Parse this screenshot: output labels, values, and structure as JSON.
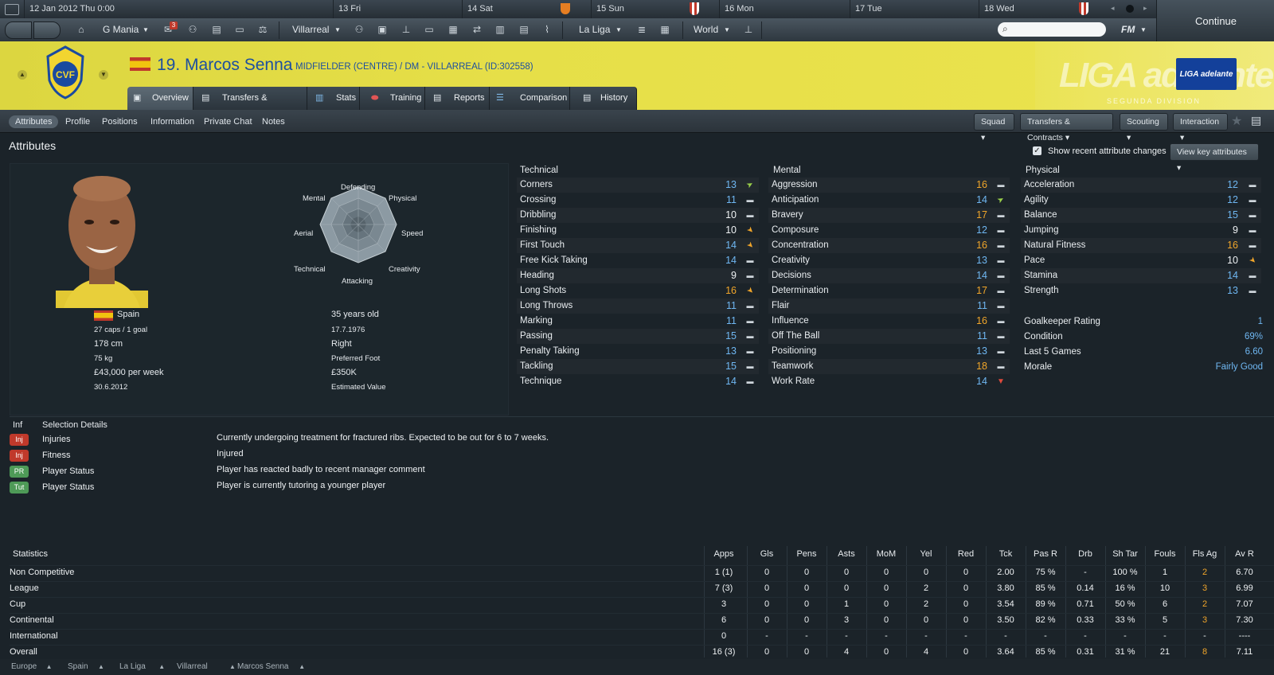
{
  "calendar": {
    "today": "12 Jan 2012  Thu  0:00",
    "days": [
      "13  Fri",
      "14  Sat",
      "15  Sun",
      "16  Mon",
      "17  Tue",
      "18  Wed"
    ]
  },
  "continue_label": "Continue",
  "toolbar": {
    "manager": "G Mania",
    "inbox_count": "3",
    "club": "Villarreal",
    "competition": "La Liga",
    "world": "World",
    "fm": "FM"
  },
  "player": {
    "name": "19. Marcos Senna",
    "subtitle": "MIDFIELDER (CENTRE) / DM - VILLARREAL (ID:302558)",
    "nation": "Spain",
    "caps": "27 caps / 1 goal",
    "height": "178 cm",
    "weight": "75 kg",
    "wage": "£43,000 per week",
    "contract": "30.6.2012",
    "age": "35 years old",
    "dob": "17.7.1976",
    "foot": "Right",
    "foot_label": "Preferred Foot",
    "value": "£350K",
    "value_label": "Estimated Value"
  },
  "league_badge": "LIGA adelante",
  "league_banner": "LIGA adelante",
  "league_sub": "SEGUNDA DIVISION",
  "tabs": [
    "Overview",
    "Transfers & Contracts",
    "Stats",
    "Training",
    "Reports",
    "Comparison",
    "History"
  ],
  "subnav": [
    "Attributes",
    "Profile",
    "Positions",
    "Information",
    "Private Chat",
    "Notes"
  ],
  "dropdowns": [
    "Squad",
    "Transfers & Contracts",
    "Scouting",
    "Interaction"
  ],
  "section_title": "Attributes",
  "show_changes": "Show recent attribute changes",
  "view_key": "View key attributes",
  "radar_labels": [
    "Defending",
    "Physical",
    "Speed",
    "Creativity",
    "Attacking",
    "Technical",
    "Aerial",
    "Mental"
  ],
  "technical": {
    "title": "Technical",
    "rows": [
      {
        "name": "Corners",
        "value": "13",
        "trend": "up",
        "color": "blue"
      },
      {
        "name": "Crossing",
        "value": "11",
        "trend": "flat",
        "color": "blue"
      },
      {
        "name": "Dribbling",
        "value": "10",
        "trend": "flat",
        "color": "white"
      },
      {
        "name": "Finishing",
        "value": "10",
        "trend": "down-orange",
        "color": "white"
      },
      {
        "name": "First Touch",
        "value": "14",
        "trend": "down-orange",
        "color": "blue"
      },
      {
        "name": "Free Kick Taking",
        "value": "14",
        "trend": "flat",
        "color": "blue"
      },
      {
        "name": "Heading",
        "value": "9",
        "trend": "flat",
        "color": "white"
      },
      {
        "name": "Long Shots",
        "value": "16",
        "trend": "down-orange",
        "color": "orange"
      },
      {
        "name": "Long Throws",
        "value": "11",
        "trend": "flat",
        "color": "blue"
      },
      {
        "name": "Marking",
        "value": "11",
        "trend": "flat",
        "color": "blue"
      },
      {
        "name": "Passing",
        "value": "15",
        "trend": "flat",
        "color": "blue"
      },
      {
        "name": "Penalty Taking",
        "value": "13",
        "trend": "flat",
        "color": "blue"
      },
      {
        "name": "Tackling",
        "value": "15",
        "trend": "flat",
        "color": "blue"
      },
      {
        "name": "Technique",
        "value": "14",
        "trend": "flat",
        "color": "blue"
      }
    ]
  },
  "mental": {
    "title": "Mental",
    "rows": [
      {
        "name": "Aggression",
        "value": "16",
        "trend": "flat",
        "color": "orange"
      },
      {
        "name": "Anticipation",
        "value": "14",
        "trend": "up",
        "color": "blue"
      },
      {
        "name": "Bravery",
        "value": "17",
        "trend": "flat",
        "color": "orange"
      },
      {
        "name": "Composure",
        "value": "12",
        "trend": "flat",
        "color": "blue"
      },
      {
        "name": "Concentration",
        "value": "16",
        "trend": "flat",
        "color": "orange"
      },
      {
        "name": "Creativity",
        "value": "13",
        "trend": "flat",
        "color": "blue"
      },
      {
        "name": "Decisions",
        "value": "14",
        "trend": "flat",
        "color": "blue"
      },
      {
        "name": "Determination",
        "value": "17",
        "trend": "flat",
        "color": "orange"
      },
      {
        "name": "Flair",
        "value": "11",
        "trend": "flat",
        "color": "blue"
      },
      {
        "name": "Influence",
        "value": "16",
        "trend": "flat",
        "color": "orange"
      },
      {
        "name": "Off The Ball",
        "value": "11",
        "trend": "flat",
        "color": "blue"
      },
      {
        "name": "Positioning",
        "value": "13",
        "trend": "flat",
        "color": "blue"
      },
      {
        "name": "Teamwork",
        "value": "18",
        "trend": "flat",
        "color": "orange"
      },
      {
        "name": "Work Rate",
        "value": "14",
        "trend": "down-red",
        "color": "blue"
      }
    ]
  },
  "physical": {
    "title": "Physical",
    "rows": [
      {
        "name": "Acceleration",
        "value": "12",
        "trend": "flat",
        "color": "blue"
      },
      {
        "name": "Agility",
        "value": "12",
        "trend": "flat",
        "color": "blue"
      },
      {
        "name": "Balance",
        "value": "15",
        "trend": "flat",
        "color": "blue"
      },
      {
        "name": "Jumping",
        "value": "9",
        "trend": "flat",
        "color": "white"
      },
      {
        "name": "Natural Fitness",
        "value": "16",
        "trend": "flat",
        "color": "orange"
      },
      {
        "name": "Pace",
        "value": "10",
        "trend": "down-orange",
        "color": "white"
      },
      {
        "name": "Stamina",
        "value": "14",
        "trend": "flat",
        "color": "blue"
      },
      {
        "name": "Strength",
        "value": "13",
        "trend": "flat",
        "color": "blue"
      }
    ],
    "extra": [
      {
        "name": "Goalkeeper Rating",
        "value": "1"
      },
      {
        "name": "Condition",
        "value": "69%"
      },
      {
        "name": "Last 5 Games",
        "value": "6.60"
      },
      {
        "name": "Morale",
        "value": "Fairly Good"
      }
    ]
  },
  "selection": {
    "col1": "Inf",
    "col2": "Selection Details",
    "rows": [
      {
        "badge": "Inj",
        "badge_color": "#c0392b",
        "name": "Injuries",
        "detail": "Currently undergoing treatment for fractured ribs. Expected to be out for 6 to 7 weeks."
      },
      {
        "badge": "Inj",
        "badge_color": "#c0392b",
        "name": "Fitness",
        "detail": "Injured"
      },
      {
        "badge": "PR",
        "badge_color": "#4e9a57",
        "name": "Player Status",
        "detail": "Player has reacted badly to recent manager comment"
      },
      {
        "badge": "Tut",
        "badge_color": "#4e9a57",
        "name": "Player Status",
        "detail": "Player is currently tutoring a younger player"
      }
    ]
  },
  "statistics": {
    "title": "Statistics",
    "columns": [
      "Apps",
      "Gls",
      "Pens",
      "Asts",
      "MoM",
      "Yel",
      "Red",
      "Tck",
      "Pas R",
      "Drb",
      "Sh Tar",
      "Fouls",
      "Fls Ag",
      "Av R"
    ],
    "rows": [
      {
        "label": "Non Competitive",
        "cells": [
          "1 (1)",
          "0",
          "0",
          "0",
          "0",
          "0",
          "0",
          "2.00",
          "75 %",
          "-",
          "100 %",
          "1",
          "2",
          "6.70"
        ]
      },
      {
        "label": "League",
        "cells": [
          "7 (3)",
          "0",
          "0",
          "0",
          "0",
          "2",
          "0",
          "3.80",
          "85 %",
          "0.14",
          "16 %",
          "10",
          "3",
          "6.99"
        ]
      },
      {
        "label": "Cup",
        "cells": [
          "3",
          "0",
          "0",
          "1",
          "0",
          "2",
          "0",
          "3.54",
          "89 %",
          "0.71",
          "50 %",
          "6",
          "2",
          "7.07"
        ]
      },
      {
        "label": "Continental",
        "cells": [
          "6",
          "0",
          "0",
          "3",
          "0",
          "0",
          "0",
          "3.50",
          "82 %",
          "0.33",
          "33 %",
          "5",
          "3",
          "7.30"
        ]
      },
      {
        "label": "International",
        "cells": [
          "0",
          "-",
          "-",
          "-",
          "-",
          "-",
          "-",
          "-",
          "-",
          "-",
          "-",
          "-",
          "-",
          "----"
        ]
      },
      {
        "label": "Overall",
        "cells": [
          "16 (3)",
          "0",
          "0",
          "4",
          "0",
          "4",
          "0",
          "3.64",
          "85 %",
          "0.31",
          "31 %",
          "21",
          "8",
          "7.11"
        ]
      }
    ]
  },
  "footer": [
    "Europe",
    "Spain",
    "La Liga",
    "Villarreal",
    "Marcos Senna"
  ]
}
